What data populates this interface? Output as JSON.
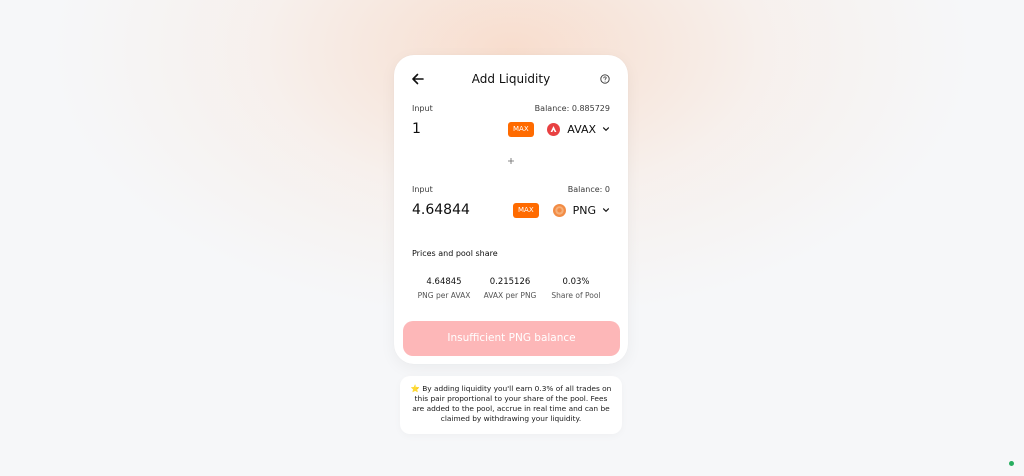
{
  "header": {
    "title": "Add Liquidity"
  },
  "input_a": {
    "label": "Input",
    "balance": "Balance: 0.885729",
    "value": "1",
    "max_label": "MAX",
    "token": "AVAX"
  },
  "input_b": {
    "label": "Input",
    "balance": "Balance: 0",
    "value": "4.64844",
    "max_label": "MAX",
    "token": "PNG"
  },
  "prices": {
    "title": "Prices and pool share",
    "stats": [
      {
        "value": "4.64845",
        "label": "PNG per AVAX"
      },
      {
        "value": "0.215126",
        "label": "AVAX per PNG"
      },
      {
        "value": "0.03%",
        "label": "Share of Pool"
      }
    ]
  },
  "submit": {
    "label": "Insufficient PNG balance"
  },
  "info": {
    "text": "⭐ By adding liquidity you'll earn 0.3% of all trades on this pair proportional to your share of the pool. Fees are added to the pool, accrue in real time and can be claimed by withdrawing your liquidity."
  },
  "colors": {
    "accent": "#ff6b00",
    "avax": "#e84142",
    "png": "#f28c45",
    "disabled_button": "#fdb7b8",
    "status": "#27ae60"
  },
  "icons": {
    "back": "arrow-left-icon",
    "help": "question-circle-icon",
    "plus": "plus-icon",
    "chevron": "chevron-down-icon"
  }
}
